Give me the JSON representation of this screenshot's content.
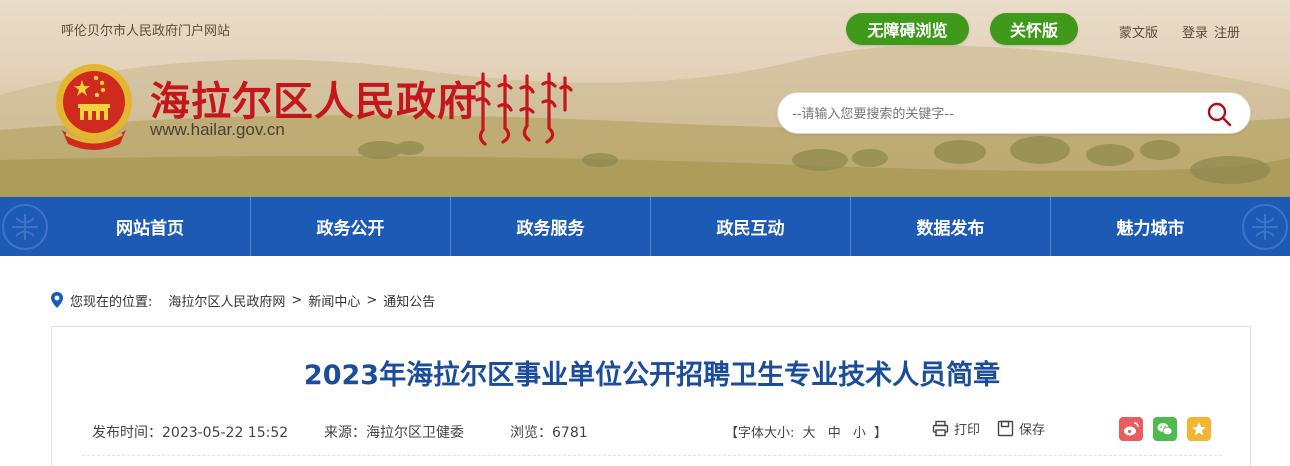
{
  "header": {
    "portal_name": "呼伦贝尔市人民政府门户网站",
    "accessibility_btn": "无障碍浏览",
    "care_btn": "关怀版",
    "mongolian_link": "蒙文版",
    "login_link": "登录",
    "register_link": "注册",
    "site_title": "海拉尔区人民政府",
    "site_url": "www.hailar.gov.cn",
    "search_placeholder": "--请输入您要搜索的关键字--",
    "accent_red": "#c4161c",
    "pill_green": "#3f9a1c"
  },
  "nav": {
    "color": "#1c5ab5",
    "items": [
      {
        "label": "网站首页"
      },
      {
        "label": "政务公开"
      },
      {
        "label": "政务服务"
      },
      {
        "label": "政民互动"
      },
      {
        "label": "数据发布"
      },
      {
        "label": "魅力城市"
      }
    ]
  },
  "breadcrumb": {
    "prefix": "您现在的位置:",
    "items": [
      "海拉尔区人民政府网",
      "新闻中心",
      "通知公告"
    ],
    "separator": ">"
  },
  "article": {
    "title": "2023年海拉尔区事业单位公开招聘卫生专业技术人员简章",
    "publish_time": "发布时间：2023-05-22 15:52",
    "source": "来源：海拉尔区卫健委",
    "views": "浏览：6781",
    "font_size_label": "【字体大小:",
    "font_large": "大",
    "font_medium": "中",
    "font_small": "小",
    "font_size_end": "】",
    "print_label": "打印",
    "save_label": "保存",
    "share_icons": [
      "weibo-icon",
      "wechat-icon",
      "favorite-star-icon"
    ]
  }
}
